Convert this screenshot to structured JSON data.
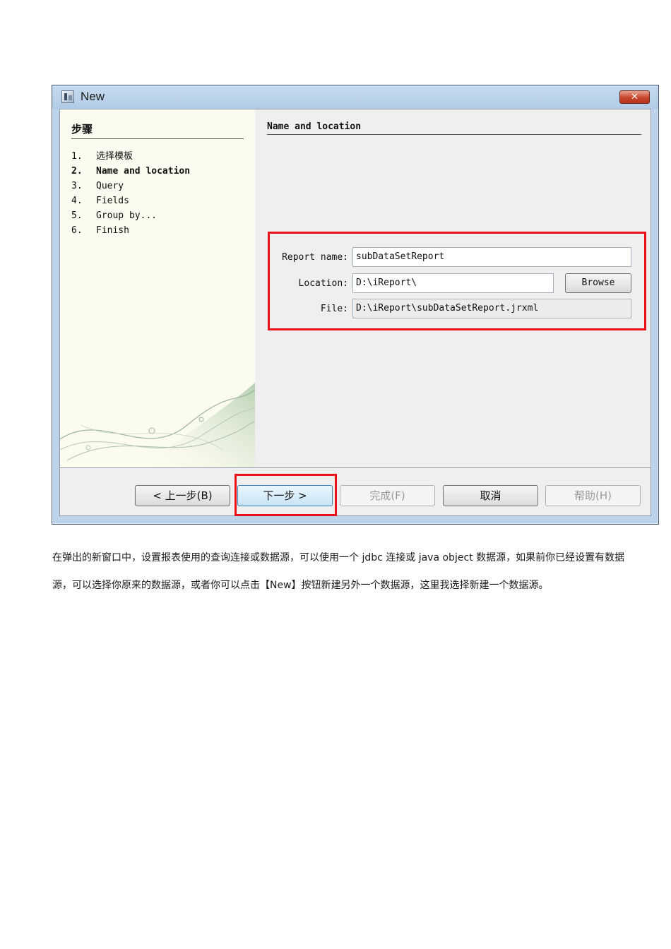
{
  "window": {
    "title": "New",
    "close_glyph": "✕"
  },
  "steps": {
    "heading": "步骤",
    "items": [
      {
        "num": "1.",
        "label": "选择模板",
        "active": false
      },
      {
        "num": "2.",
        "label": "Name and location",
        "active": true
      },
      {
        "num": "3.",
        "label": "Query",
        "active": false
      },
      {
        "num": "4.",
        "label": "Fields",
        "active": false
      },
      {
        "num": "5.",
        "label": "Group by...",
        "active": false
      },
      {
        "num": "6.",
        "label": "Finish",
        "active": false
      }
    ]
  },
  "content": {
    "heading": "Name and location",
    "report_name_label": "Report name:",
    "report_name_value": "subDataSetReport",
    "location_label": "Location:",
    "location_value": "D:\\iReport\\",
    "browse_label": "Browse",
    "file_label": "File:",
    "file_value": "D:\\iReport\\subDataSetReport.jrxml"
  },
  "footer": {
    "back_label": "< 上一步(B)",
    "next_label": "下一步 >",
    "finish_label": "完成(F)",
    "cancel_label": "取消",
    "help_label": "帮助(H)"
  },
  "annotation_color": "#e8121b",
  "caption": "在弹出的新窗口中，设置报表使用的查询连接或数据源，可以使用一个 jdbc 连接或 java object 数据源，如果前你已经设置有数据源，可以选择你原来的数据源，或者你可以点击【New】按钮新建另外一个数据源，这里我选择新建一个数据源。"
}
